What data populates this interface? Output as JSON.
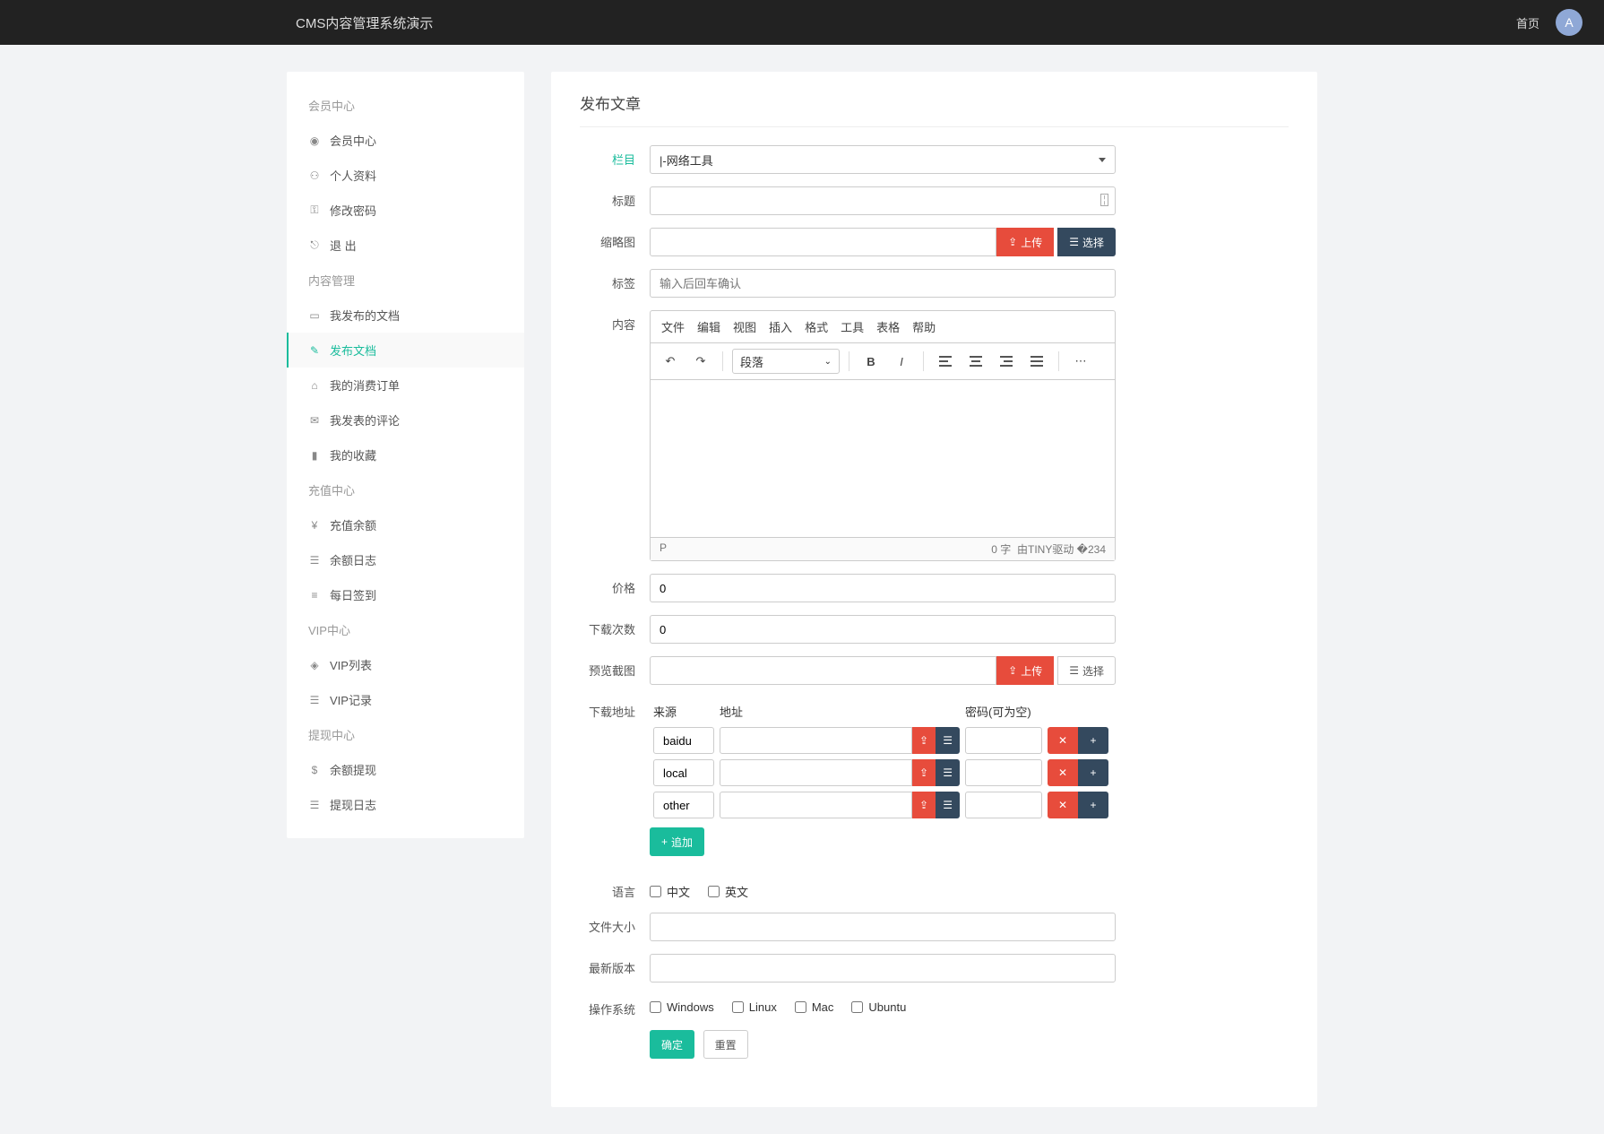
{
  "topbar": {
    "brand": "CMS内容管理系统演示",
    "home": "首页",
    "avatar": "A"
  },
  "sidebar": {
    "s1": {
      "head": "会员中心",
      "items": [
        {
          "icon": "user-circle",
          "label": "会员中心"
        },
        {
          "icon": "user",
          "label": "个人资料"
        },
        {
          "icon": "key",
          "label": "修改密码"
        },
        {
          "icon": "sign-out",
          "label": "退 出"
        }
      ]
    },
    "s2": {
      "head": "内容管理",
      "items": [
        {
          "icon": "doc",
          "label": "我发布的文档"
        },
        {
          "icon": "edit",
          "label": "发布文档",
          "active": true
        },
        {
          "icon": "bag",
          "label": "我的消费订单"
        },
        {
          "icon": "comment",
          "label": "我发表的评论"
        },
        {
          "icon": "bookmark",
          "label": "我的收藏"
        }
      ]
    },
    "s3": {
      "head": "充值中心",
      "items": [
        {
          "icon": "yen",
          "label": "充值余额"
        },
        {
          "icon": "list",
          "label": "余额日志"
        }
      ]
    },
    "s4": {
      "items": [
        {
          "icon": "signin",
          "label": "每日签到"
        }
      ]
    },
    "s5": {
      "head": "VIP中心",
      "items": [
        {
          "icon": "diamond",
          "label": "VIP列表"
        },
        {
          "icon": "list",
          "label": "VIP记录"
        }
      ]
    },
    "s6": {
      "head": "提现中心",
      "items": [
        {
          "icon": "dollar",
          "label": "余额提现"
        },
        {
          "icon": "list",
          "label": "提现日志"
        }
      ]
    }
  },
  "form": {
    "title": "发布文章",
    "labels": {
      "category": "栏目",
      "title_f": "标题",
      "thumb": "缩略图",
      "tags": "标签",
      "content": "内容",
      "price": "价格",
      "downloads": "下载次数",
      "preview": "预览截图",
      "dl_addr": "下载地址",
      "lang": "语言",
      "filesize": "文件大小",
      "version": "最新版本",
      "os": "操作系统"
    },
    "category_value": "|-网络工具",
    "tags_placeholder": "输入后回车确认",
    "upload_btn": "上传",
    "select_btn": "选择",
    "price_value": "0",
    "downloads_value": "0",
    "editor": {
      "menus": [
        "文件",
        "编辑",
        "视图",
        "插入",
        "格式",
        "工具",
        "表格",
        "帮助"
      ],
      "format_sel": "段落",
      "path": "P",
      "words": "0 字",
      "powered": "由TINY驱动"
    },
    "dl": {
      "cols": {
        "source": "来源",
        "url": "地址",
        "pwd": "密码(可为空)"
      },
      "rows": [
        {
          "source": "baidu"
        },
        {
          "source": "local"
        },
        {
          "source": "other"
        }
      ],
      "add": "追加"
    },
    "lang_opts": [
      "中文",
      "英文"
    ],
    "os_opts": [
      "Windows",
      "Linux",
      "Mac",
      "Ubuntu"
    ],
    "submit": "确定",
    "reset": "重置"
  }
}
